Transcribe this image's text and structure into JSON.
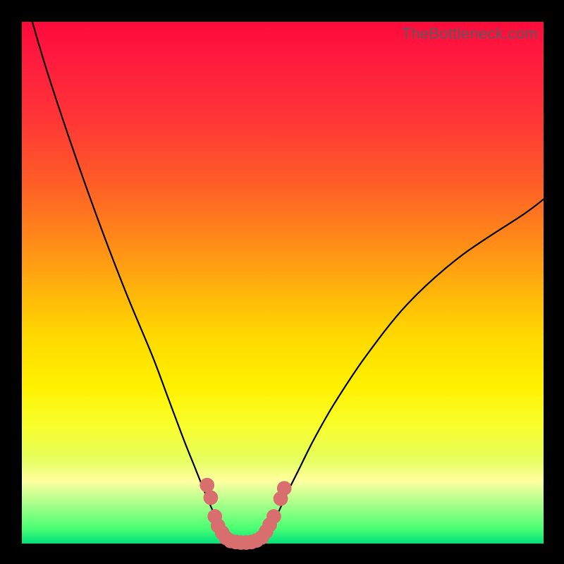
{
  "watermark": "TheBottleneck.com",
  "chart_data": {
    "type": "line",
    "title": "",
    "subtitle": "",
    "xlabel": "",
    "ylabel": "",
    "xlim": [
      0,
      100
    ],
    "ylim": [
      0,
      100
    ],
    "grid": false,
    "legend": false,
    "background": "heat-gradient red-to-green (bottleneck heat)",
    "series": [
      {
        "name": "left-curve",
        "color": "#000000",
        "x": [
          2,
          5,
          10,
          15,
          20,
          25,
          28,
          31,
          33,
          35,
          36.5,
          38,
          39,
          39.8
        ],
        "y": [
          100,
          90,
          75,
          61,
          48,
          36,
          28,
          20,
          15,
          10,
          6.5,
          3.5,
          1.5,
          0.4
        ]
      },
      {
        "name": "right-curve",
        "color": "#000000",
        "x": [
          46.2,
          47,
          48,
          49.4,
          51,
          53,
          56,
          60,
          66,
          74,
          84,
          96,
          100
        ],
        "y": [
          0.4,
          1.5,
          3.5,
          6.5,
          10,
          14,
          20,
          27,
          36,
          46,
          55,
          63,
          66
        ]
      }
    ],
    "markers": [
      {
        "name": "valley-dots",
        "shape": "circle",
        "color": "#d86e6e",
        "radius_pct": 1.4,
        "points": [
          {
            "x": 35.5,
            "y": 11.2
          },
          {
            "x": 36.2,
            "y": 8.8
          },
          {
            "x": 37.0,
            "y": 5.2
          },
          {
            "x": 37.6,
            "y": 3.4
          },
          {
            "x": 38.4,
            "y": 2.1
          },
          {
            "x": 39.1,
            "y": 1.1
          },
          {
            "x": 40.0,
            "y": 0.5
          },
          {
            "x": 41.0,
            "y": 0.3
          },
          {
            "x": 42.0,
            "y": 0.2
          },
          {
            "x": 43.0,
            "y": 0.2
          },
          {
            "x": 44.0,
            "y": 0.3
          },
          {
            "x": 45.0,
            "y": 0.6
          },
          {
            "x": 46.0,
            "y": 1.2
          },
          {
            "x": 46.8,
            "y": 2.3
          },
          {
            "x": 47.5,
            "y": 3.6
          },
          {
            "x": 48.3,
            "y": 5.2
          },
          {
            "x": 49.6,
            "y": 8.6
          },
          {
            "x": 50.3,
            "y": 10.6
          }
        ]
      }
    ]
  }
}
